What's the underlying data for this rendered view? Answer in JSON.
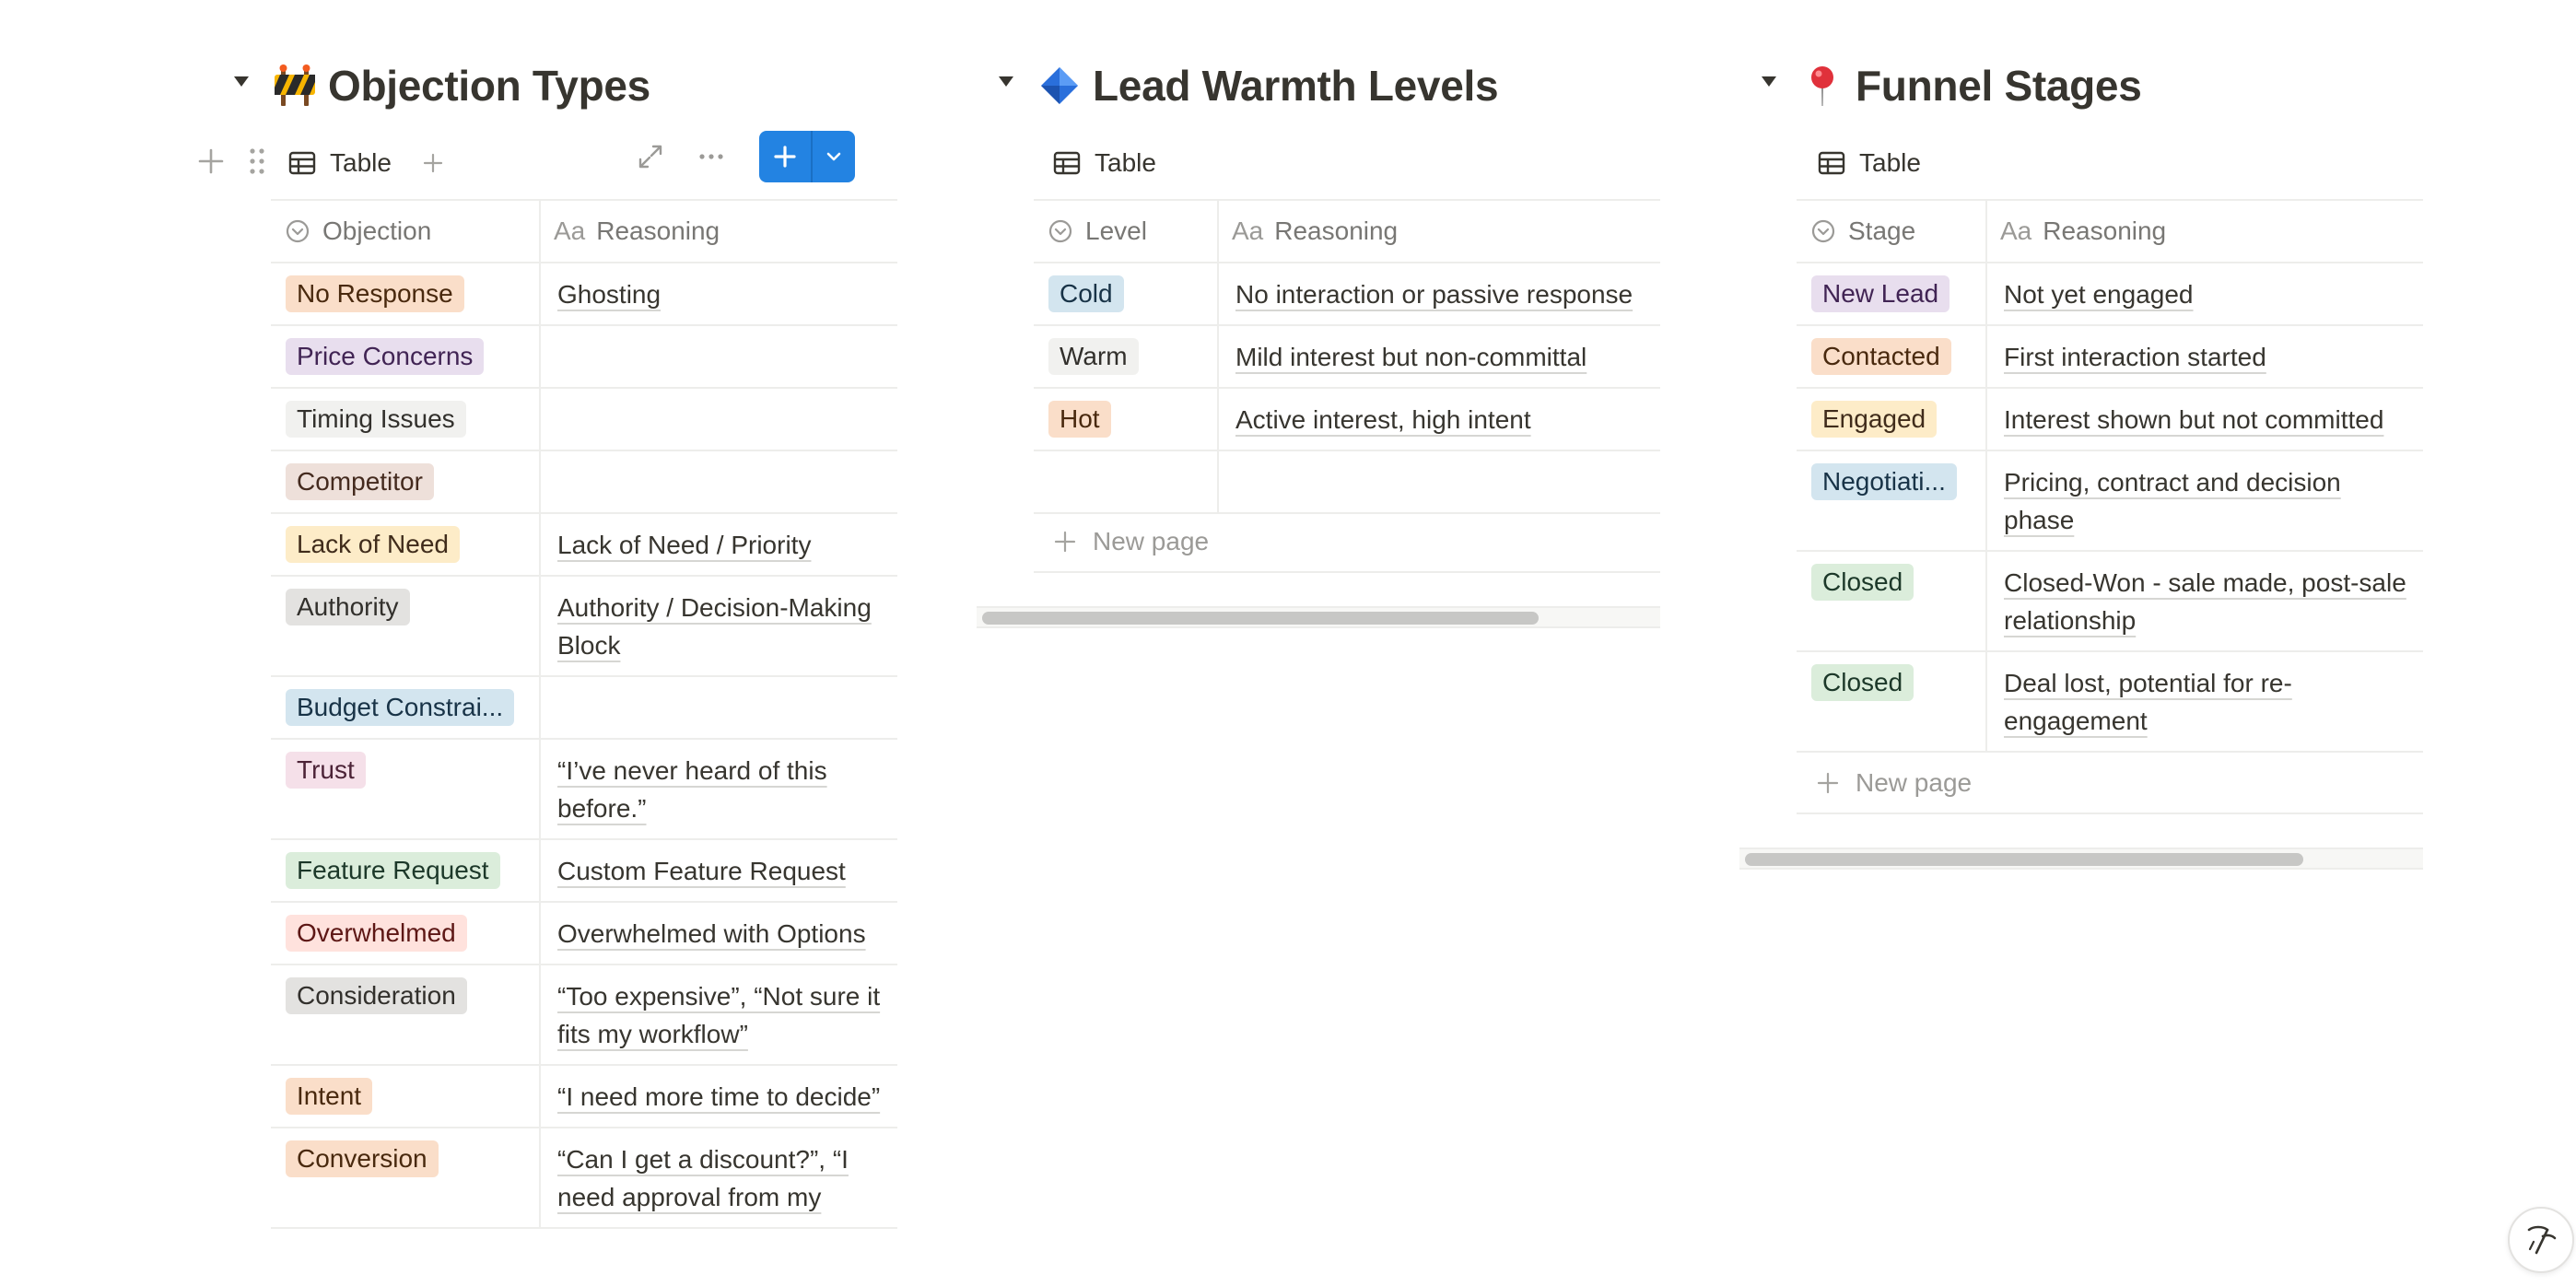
{
  "colors": {
    "accent": "#2383e2",
    "tag_orange": "#fadec9",
    "tag_purple": "#e8deee",
    "tag_default": "#f1f1ef",
    "tag_brown": "#eee0da",
    "tag_yellow": "#fdecc8",
    "tag_gray": "#e3e2e0",
    "tag_blue": "#d3e5ef",
    "tag_pink": "#f5e0e9",
    "tag_green": "#dbeddb",
    "tag_red": "#ffe2dd"
  },
  "databases": [
    {
      "title": "Objection Types",
      "emoji": "construction-sign-icon",
      "view_label": "Table",
      "select_header": "Objection",
      "text_header": "Reasoning",
      "text_header_prefix": "Aa",
      "rows": [
        {
          "tag": "No Response",
          "color": "#fadec9",
          "text_color": "#49290e",
          "reason": "Ghosting"
        },
        {
          "tag": "Price Concerns",
          "color": "#e8deee",
          "text_color": "#412454",
          "reason": ""
        },
        {
          "tag": "Timing Issues",
          "color": "#f1f1ef",
          "text_color": "#32302c",
          "reason": ""
        },
        {
          "tag": "Competitor",
          "color": "#eee0da",
          "text_color": "#442a1e",
          "reason": ""
        },
        {
          "tag": "Lack of Need",
          "color": "#fdecc8",
          "text_color": "#402c1b",
          "reason": "Lack of Need / Priority"
        },
        {
          "tag": "Authority",
          "color": "#e3e2e0",
          "text_color": "#32302c",
          "reason": "Authority / Decision-Making Block"
        },
        {
          "tag": "Budget Constrai...",
          "color": "#d3e5ef",
          "text_color": "#183347",
          "reason": ""
        },
        {
          "tag": "Trust",
          "color": "#f5e0e9",
          "text_color": "#4c2337",
          "reason": "“I’ve never heard of this before.”"
        },
        {
          "tag": "Feature Request",
          "color": "#dbeddb",
          "text_color": "#1c3829",
          "reason": "Custom Feature Request"
        },
        {
          "tag": "Overwhelmed",
          "color": "#ffe2dd",
          "text_color": "#5d1715",
          "reason": "Overwhelmed with Options"
        },
        {
          "tag": "Consideration",
          "color": "#e3e2e0",
          "text_color": "#32302c",
          "reason": "“Too expensive”, “Not sure it fits my workflow”"
        },
        {
          "tag": "Intent",
          "color": "#fadec9",
          "text_color": "#49290e",
          "reason": "“I need more time to decide”"
        },
        {
          "tag": "Conversion",
          "color": "#fadec9",
          "text_color": "#49290e",
          "reason": "“Can I get a discount?”, “I need approval from my"
        }
      ]
    },
    {
      "title": "Lead Warmth Levels",
      "emoji": "blue-diamond-icon",
      "view_label": "Table",
      "select_header": "Level",
      "text_header": "Reasoning",
      "text_header_prefix": "Aa",
      "new_page_label": "New page",
      "rows": [
        {
          "tag": "Cold",
          "color": "#d3e5ef",
          "text_color": "#183347",
          "reason": "No interaction or passive response"
        },
        {
          "tag": "Warm",
          "color": "#f1f1ef",
          "text_color": "#32302c",
          "reason": "Mild interest but non-committal"
        },
        {
          "tag": "Hot",
          "color": "#fadec9",
          "text_color": "#49290e",
          "reason": "Active interest, high intent"
        },
        {
          "tag": "",
          "color": "",
          "text_color": "",
          "reason": ""
        }
      ]
    },
    {
      "title": "Funnel Stages",
      "emoji": "round-pushpin-icon",
      "view_label": "Table",
      "select_header": "Stage",
      "text_header": "Reasoning",
      "text_header_prefix": "Aa",
      "new_page_label": "New page",
      "rows": [
        {
          "tag": "New Lead",
          "color": "#e8deee",
          "text_color": "#412454",
          "reason": "Not yet engaged"
        },
        {
          "tag": "Contacted",
          "color": "#fadec9",
          "text_color": "#49290e",
          "reason": "First interaction started"
        },
        {
          "tag": "Engaged",
          "color": "#fdecc8",
          "text_color": "#402c1b",
          "reason": "Interest shown but not committed"
        },
        {
          "tag": "Negotiati...",
          "color": "#d3e5ef",
          "text_color": "#183347",
          "reason": "Pricing, contract and decision phase"
        },
        {
          "tag": "Closed",
          "color": "#dbeddb",
          "text_color": "#1c3829",
          "reason": "Closed-Won - sale made, post-sale relationship"
        },
        {
          "tag": "Closed",
          "color": "#dbeddb",
          "text_color": "#1c3829",
          "reason": "Deal lost, potential for re-engagement"
        }
      ]
    }
  ]
}
